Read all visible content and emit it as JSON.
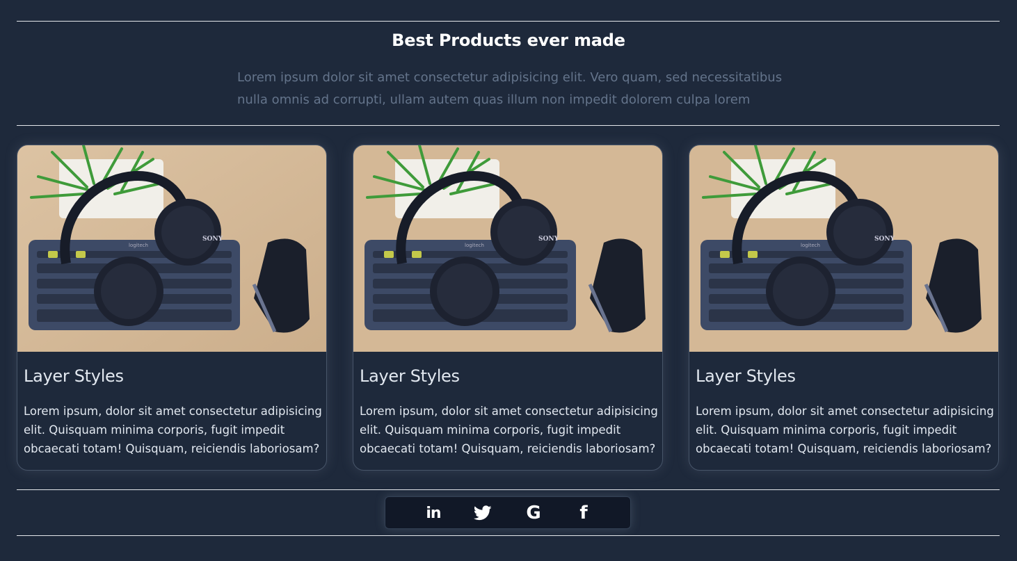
{
  "header": {
    "title": "Best Products ever made",
    "lead": "Lorem ipsum dolor sit amet consectetur adipisicing elit. Vero quam, sed necessitatibus nulla omnis ad corrupti, ullam autem quas illum non impedit dolorem culpa lorem"
  },
  "cards": [
    {
      "title": "Layer Styles",
      "text": "Lorem ipsum, dolor sit amet consectetur adipisicing elit. Quisquam minima corporis, fugit impedit obcaecati totam! Quisquam, reiciendis laboriosam?",
      "image_brand": "SONY",
      "keyboard_brand": "logitech"
    },
    {
      "title": "Layer Styles",
      "text": "Lorem ipsum, dolor sit amet consectetur adipisicing elit. Quisquam minima corporis, fugit impedit obcaecati totam! Quisquam, reiciendis laboriosam?",
      "image_brand": "SONY",
      "keyboard_brand": "logitech"
    },
    {
      "title": "Layer Styles",
      "text": "Lorem ipsum, dolor sit amet consectetur adipisicing elit. Quisquam minima corporis, fugit impedit obcaecati totam! Quisquam, reiciendis laboriosam?",
      "image_brand": "SONY",
      "keyboard_brand": "logitech"
    }
  ],
  "social": {
    "icons": [
      "linkedin-icon",
      "twitter-icon",
      "google-icon",
      "facebook-icon"
    ],
    "linkedin_glyph": "in",
    "google_glyph": "G",
    "facebook_glyph": "f"
  },
  "colors": {
    "background": "#1e293b",
    "lead_text": "#64748b",
    "card_border": "#475569",
    "social_bar": "#111827"
  }
}
